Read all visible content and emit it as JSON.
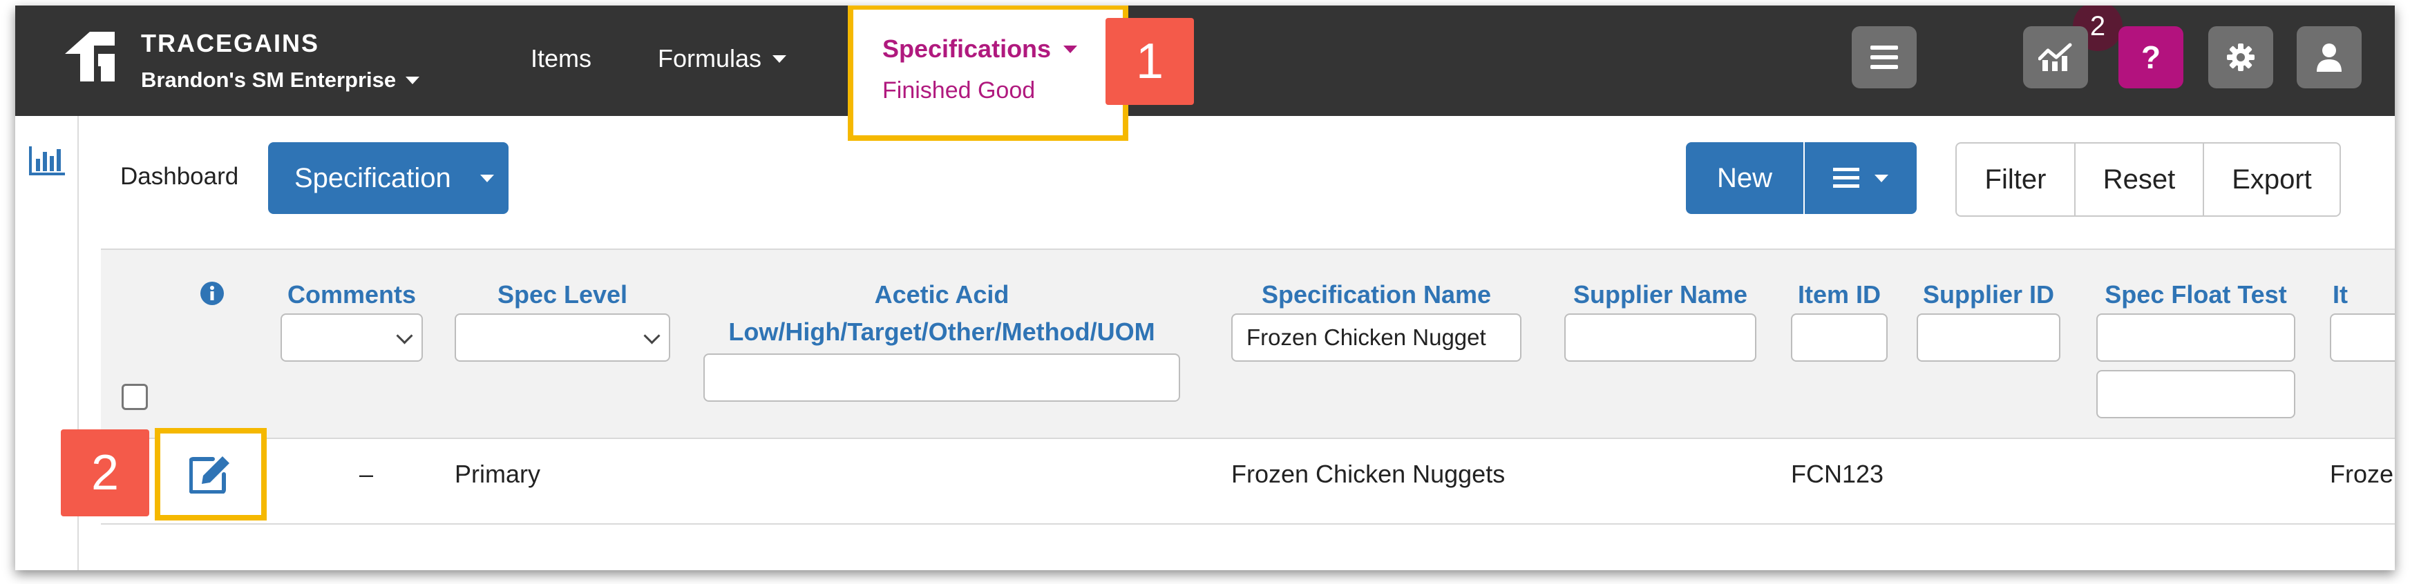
{
  "app": {
    "brand": "TRACEGAINS",
    "enterprise": "Brandon's SM Enterprise"
  },
  "nav": {
    "items": "Items",
    "formulas": "Formulas",
    "specifications": "Specifications",
    "specifications_sub": "Finished Good"
  },
  "callouts": {
    "one": "1",
    "two": "2"
  },
  "notifications": {
    "count": "2"
  },
  "icons": {
    "rail": "bar-chart-icon",
    "menu": "hamburger-icon",
    "analytics": "chart-icon",
    "help": "question-icon",
    "settings": "gear-icon",
    "user": "user-icon",
    "info": "info-icon",
    "edit": "edit-icon"
  },
  "toolbar": {
    "dashboard": "Dashboard",
    "specification": "Specification",
    "new": "New",
    "filter": "Filter",
    "reset": "Reset",
    "export": "Export"
  },
  "columns": {
    "comments": "Comments",
    "spec_level": "Spec Level",
    "acetic_acid_line1": "Acetic Acid",
    "acetic_acid_line2": "Low/High/Target/Other/Method/UOM",
    "specification_name": "Specification Name",
    "supplier_name": "Supplier Name",
    "item_id": "Item ID",
    "supplier_id": "Supplier ID",
    "spec_float_test": "Spec Float Test",
    "partial_next": "It"
  },
  "filters": {
    "specification_name": "Frozen Chicken Nugget"
  },
  "row": {
    "comments": "–",
    "spec_level": "Primary",
    "specification_name": "Frozen Chicken Nuggets",
    "item_id": "FCN123",
    "partial_next": "Frozen"
  },
  "colors": {
    "nav_bg": "#343434",
    "accent": "#b0197e",
    "primary": "#2f74b5",
    "highlight": "#f5b800",
    "callout": "#f45a4a"
  }
}
